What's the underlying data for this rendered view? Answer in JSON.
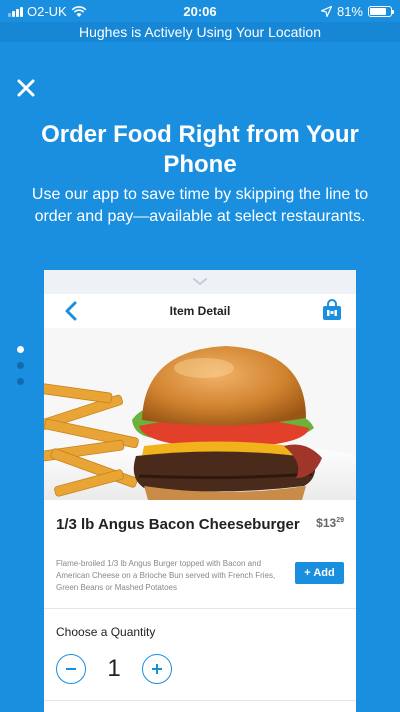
{
  "status_bar": {
    "carrier": "O2-UK",
    "time": "20:06",
    "battery": "81%",
    "battery_level": 0.81
  },
  "location_banner": "Hughes is Actively Using Your Location",
  "headline": "Order Food Right from Your Phone",
  "subtext": "Use our app to save time by skipping the line to order and pay—available at select restaurants.",
  "pager": {
    "count": 3,
    "active": 0
  },
  "card": {
    "header_title": "Item Detail",
    "item_name": "1/3 lb Angus Bacon Cheeseburger",
    "price_main": "$13",
    "price_cents": "29",
    "description": "Flame-broiled 1/3 lb Angus Burger topped with Bacon and American Cheese on a Brioche Bun served with French Fries, Green Beans or Mashed Potatoes",
    "add_label": "+ Add",
    "quantity_label": "Choose a Quantity",
    "quantity": "1"
  },
  "colors": {
    "accent": "#1b8fdf",
    "banner": "#1786d4"
  },
  "icons": [
    "close-icon",
    "chevron-down-icon",
    "back-chevron-icon",
    "shopping-bag-icon",
    "minus-icon",
    "plus-icon",
    "wifi-icon",
    "location-arrow-icon"
  ]
}
